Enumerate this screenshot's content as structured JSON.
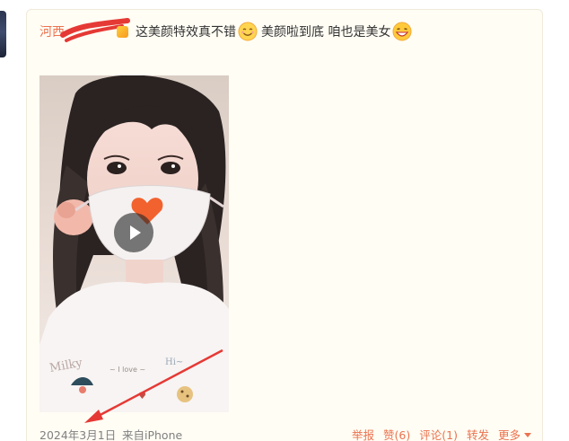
{
  "post": {
    "username": "河西",
    "text_part1": "这美颜特效真不错",
    "text_part2": "美颜啦到底 咱也是美女",
    "emoji_1": "smile-emoji",
    "emoji_2": "grin-emoji"
  },
  "video": {
    "play_icon": "play-icon"
  },
  "footer": {
    "timestamp": "2024年3月1日",
    "source": "来自iPhone",
    "report_label": "举报",
    "like_label": "赞(6)",
    "comment_label": "评论(1)",
    "repost_label": "转发",
    "more_label": "更多"
  },
  "colors": {
    "accent": "#eb7350",
    "card_bg": "#fffdf4",
    "annotation": "#e53935"
  }
}
